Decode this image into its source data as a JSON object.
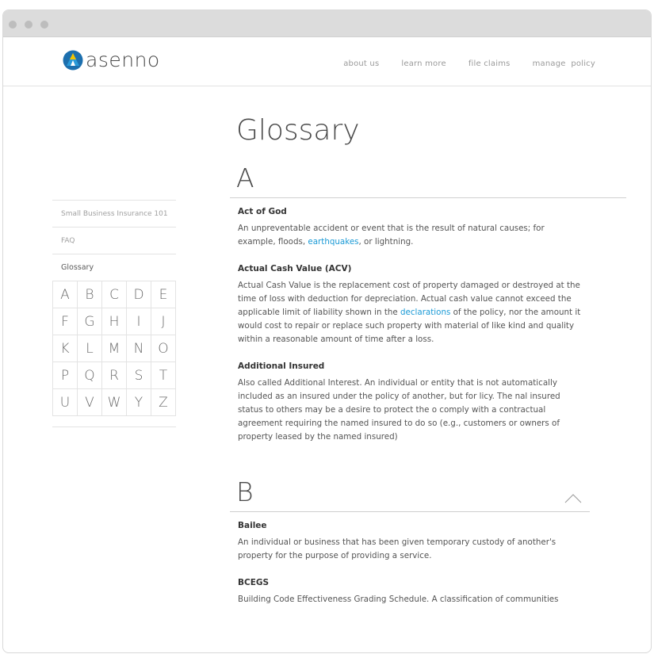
{
  "brand": {
    "name": "asenno",
    "mark_colors": {
      "outer": "#1c6fae",
      "inner": "#2a9ad8",
      "accent": "#f2c400"
    }
  },
  "nav": {
    "items": [
      "about us",
      "learn more",
      "file claims",
      "manage  policy"
    ]
  },
  "sidebar": {
    "items": [
      {
        "label": "Small Business Insurance 101"
      },
      {
        "label": "FAQ"
      },
      {
        "label": "Glossary"
      }
    ],
    "alphabet": [
      "A",
      "B",
      "C",
      "D",
      "E",
      "F",
      "G",
      "H",
      "I",
      "J",
      "K",
      "L",
      "M",
      "N",
      "O",
      "P",
      "Q",
      "R",
      "S",
      "T",
      "U",
      "V",
      "W",
      "Y",
      "Z"
    ]
  },
  "main": {
    "title": "Glossary",
    "section_a": {
      "letter": "A",
      "terms": [
        {
          "term": "Act of God",
          "before": "An unpreventable accident or event that is the result of natural causes; for example, floods, ",
          "link": "earthquakes",
          "after": ", or lightning."
        },
        {
          "term": "Actual Cash Value (ACV)",
          "before": "Actual Cash Value is the replacement cost of property damaged or destroyed at the time of loss with deduction for depreciation. Actual cash value cannot exceed the applicable limit of liability shown in the ",
          "link": "declarations",
          "after": " of the policy, nor the amount it would cost to repair or replace such property with material of like kind and quality within a reasonable amount of time after a loss."
        },
        {
          "term": "Additional Insured",
          "text": "Also called Additional Interest. An individual or entity that is not automatically included as an insured under the policy of another, but for licy. The nal insured status to others may be a desire to protect the o comply with a contractual agreement requiring the named insured to do so (e.g., customers or owners of property leased by the named insured)"
        }
      ]
    },
    "section_b": {
      "letter": "B",
      "terms": [
        {
          "term": "Bailee",
          "text": "An individual or business that has been given temporary custody of another's property for the purpose of providing a service."
        },
        {
          "term": "BCEGS",
          "text": "Building Code Effectiveness Grading Schedule. A classification of communities"
        }
      ]
    }
  },
  "colors": {
    "link": "#1a9ad6",
    "titlebar": "#dcdcdc"
  }
}
